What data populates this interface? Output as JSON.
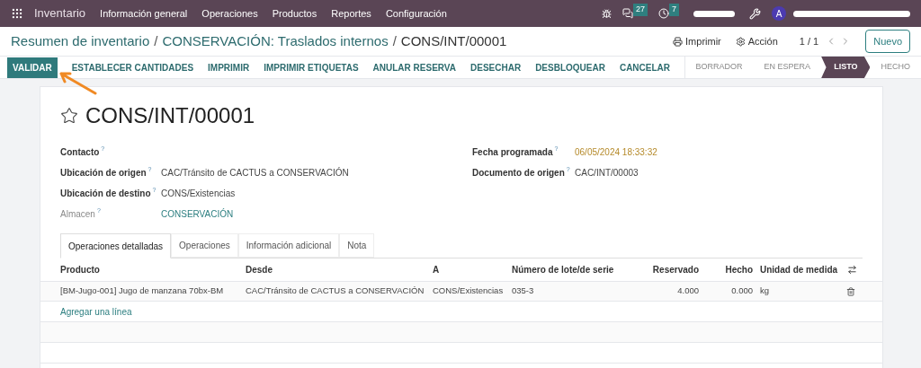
{
  "navbar": {
    "app": "Inventario",
    "menu": [
      "Información general",
      "Operaciones",
      "Productos",
      "Reportes",
      "Configuración"
    ],
    "messages_badge": "27",
    "activities_badge": "7",
    "avatar": "A"
  },
  "breadcrumb": {
    "parts": [
      {
        "label": "Resumen de inventario",
        "separator": "/"
      },
      {
        "label": "CONSERVACIÓN: Traslados internos",
        "separator": "/"
      }
    ],
    "current": "CONS/INT/00001"
  },
  "actions": {
    "print": "Imprimir",
    "action": "Acción",
    "pager": "1 / 1",
    "new": "Nuevo"
  },
  "buttons": [
    {
      "label": "VALIDAR",
      "primary": true
    },
    {
      "label": "ESTABLECER CANTIDADES",
      "primary": false
    },
    {
      "label": "IMPRIMIR",
      "primary": false
    },
    {
      "label": "IMPRIMIR ETIQUETAS",
      "primary": false
    },
    {
      "label": "ANULAR RESERVA",
      "primary": false
    },
    {
      "label": "DESECHAR",
      "primary": false
    },
    {
      "label": "DESBLOQUEAR",
      "primary": false
    },
    {
      "label": "CANCELAR",
      "primary": false
    }
  ],
  "stages": [
    {
      "label": "BORRADOR",
      "selected": false
    },
    {
      "label": "EN ESPERA",
      "selected": false
    },
    {
      "label": "LISTO",
      "selected": true
    },
    {
      "label": "HECHO",
      "selected": false
    }
  ],
  "record": {
    "title": "CONS/INT/00001",
    "starred": false
  },
  "fields_left": [
    {
      "label": "Contacto",
      "help": "?",
      "muted": false
    },
    {
      "label": "Ubicación de origen",
      "help": "?",
      "value": "CAC/Tránsito de CACTUS a CONSERVACIÓN",
      "kind": "text",
      "muted": false
    },
    {
      "label": "Ubicación de destino",
      "help": "?",
      "value": "CONS/Existencias",
      "kind": "text",
      "muted": false
    },
    {
      "label": "Almacen",
      "help": "?",
      "value": "CONSERVACIÓN",
      "kind": "link",
      "muted": true
    }
  ],
  "fields_right": [
    {
      "label": "Fecha programada",
      "help": "?",
      "value": "06/05/2024 18:33:32",
      "kind": "date"
    },
    {
      "label": "Documento de origen",
      "help": "?",
      "value": "CAC/INT/00003",
      "kind": "text"
    }
  ],
  "tabs": [
    {
      "label": "Operaciones detalladas",
      "selected": true
    },
    {
      "label": "Operaciones",
      "selected": false
    },
    {
      "label": "Información adicional",
      "selected": false
    },
    {
      "label": "Nota",
      "selected": false
    }
  ],
  "table": {
    "columns": [
      "Producto",
      "Desde",
      "A",
      "Número de lote/de serie",
      "Reservado",
      "Hecho",
      "Unidad de medida"
    ],
    "rows": [
      [
        "[BM-Jugo-001] Jugo de manzana 70bx-BM",
        "CAC/Tránsito de CACTUS a CONSERVACIÓN",
        "CONS/Existencias",
        "035-3",
        "4.000",
        "0.000",
        "kg"
      ]
    ],
    "add_line": "Agregar una línea"
  }
}
